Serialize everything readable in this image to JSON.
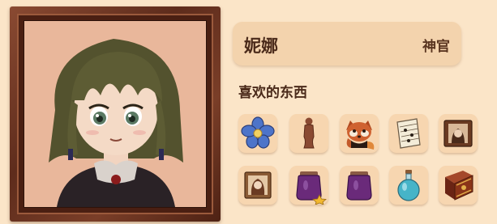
{
  "character": {
    "name": "妮娜",
    "class": "神官"
  },
  "likes": {
    "heading": "喜欢的东西",
    "items": [
      {
        "icon": "blue-flower-icon"
      },
      {
        "icon": "wooden-statue-icon"
      },
      {
        "icon": "red-panda-icon"
      },
      {
        "icon": "sheet-music-icon"
      },
      {
        "icon": "framed-portrait-icon"
      },
      {
        "icon": "framed-portrait-icon"
      },
      {
        "icon": "purple-jam-jar-icon",
        "badge": "star"
      },
      {
        "icon": "purple-jam-jar-icon"
      },
      {
        "icon": "blue-potion-icon"
      },
      {
        "icon": "spell-book-icon"
      }
    ]
  }
}
